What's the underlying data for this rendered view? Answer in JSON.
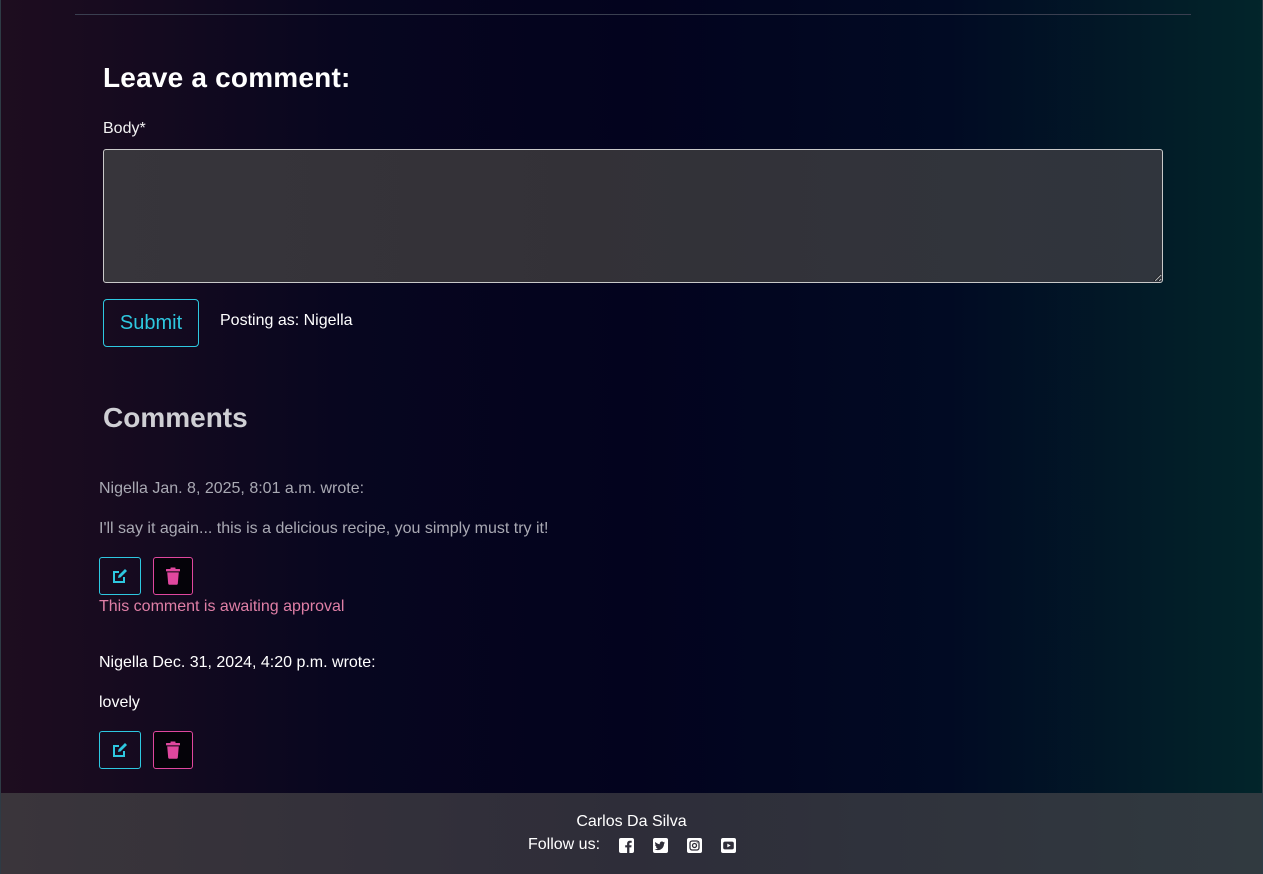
{
  "form": {
    "title": "Leave a comment:",
    "body_label": "Body*",
    "body_value": "",
    "submit_label": "Submit",
    "posting_as": "Posting as: Nigella"
  },
  "comments_section": {
    "title": "Comments",
    "items": [
      {
        "meta": "Nigella Jan. 8, 2025, 8:01 a.m. wrote:",
        "body": "I'll say it again... this is a delicious recipe, you simply must try it!",
        "status": "This comment is awaiting approval",
        "faded": true
      },
      {
        "meta": "Nigella Dec. 31, 2024, 4:20 p.m. wrote:",
        "body": "lovely",
        "status": "",
        "faded": false
      }
    ]
  },
  "footer": {
    "name": "Carlos Da Silva",
    "follow_label": "Follow us:",
    "social_icons": [
      "facebook-icon",
      "twitter-icon",
      "instagram-icon",
      "youtube-icon"
    ]
  },
  "colors": {
    "accent_cyan": "#2ec8e0",
    "accent_pink": "#e0479e",
    "awaiting_text": "#e07fa6"
  }
}
